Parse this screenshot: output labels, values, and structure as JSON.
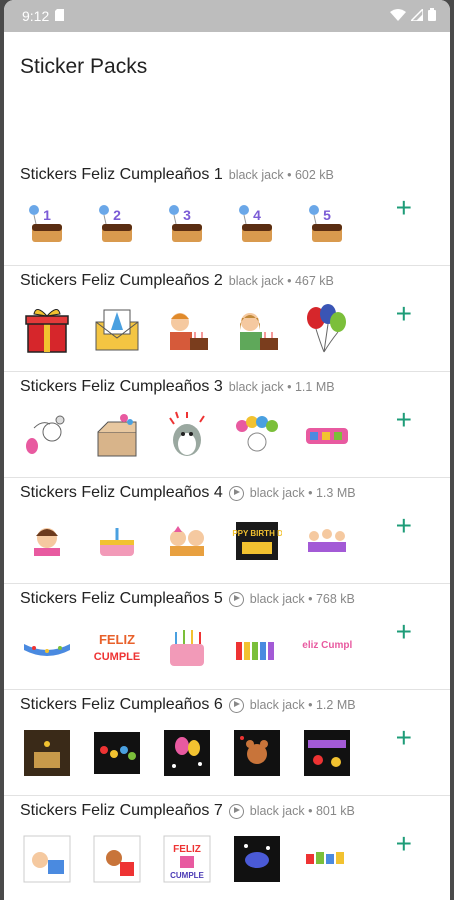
{
  "status_bar": {
    "time": "9:12"
  },
  "app": {
    "title": "Sticker Packs"
  },
  "packs": [
    {
      "name": "Stickers Feliz Cumpleaños 1",
      "author": "black jack",
      "size": "602 kB",
      "animated": false,
      "add_label": "+"
    },
    {
      "name": "Stickers Feliz Cumpleaños 2",
      "author": "black jack",
      "size": "467 kB",
      "animated": false,
      "add_label": "+"
    },
    {
      "name": "Stickers Feliz Cumpleaños 3",
      "author": "black jack",
      "size": "1.1 MB",
      "animated": false,
      "add_label": "+"
    },
    {
      "name": "Stickers Feliz Cumpleaños 4",
      "author": "black jack",
      "size": "1.3 MB",
      "animated": true,
      "add_label": "+"
    },
    {
      "name": "Stickers Feliz Cumpleaños 5",
      "author": "black jack",
      "size": "768 kB",
      "animated": true,
      "add_label": "+"
    },
    {
      "name": "Stickers Feliz Cumpleaños 6",
      "author": "black jack",
      "size": "1.2 MB",
      "animated": true,
      "add_label": "+"
    },
    {
      "name": "Stickers Feliz Cumpleaños 7",
      "author": "black jack",
      "size": "801 kB",
      "animated": true,
      "add_label": "+"
    }
  ],
  "sticker_text": {
    "cake_numbers": [
      "1",
      "2",
      "3",
      "4",
      "5"
    ],
    "happy_birthday_day": "HAPPY BIRTH DAY",
    "feliz": "FELIZ",
    "cumple": "CUMPLE",
    "feliz_cumple_pink": "Feliz Cumple"
  },
  "colors": {
    "accent": "#1e9c78",
    "status_bar": "#bdbdbd",
    "divider": "#e2e2e2"
  }
}
